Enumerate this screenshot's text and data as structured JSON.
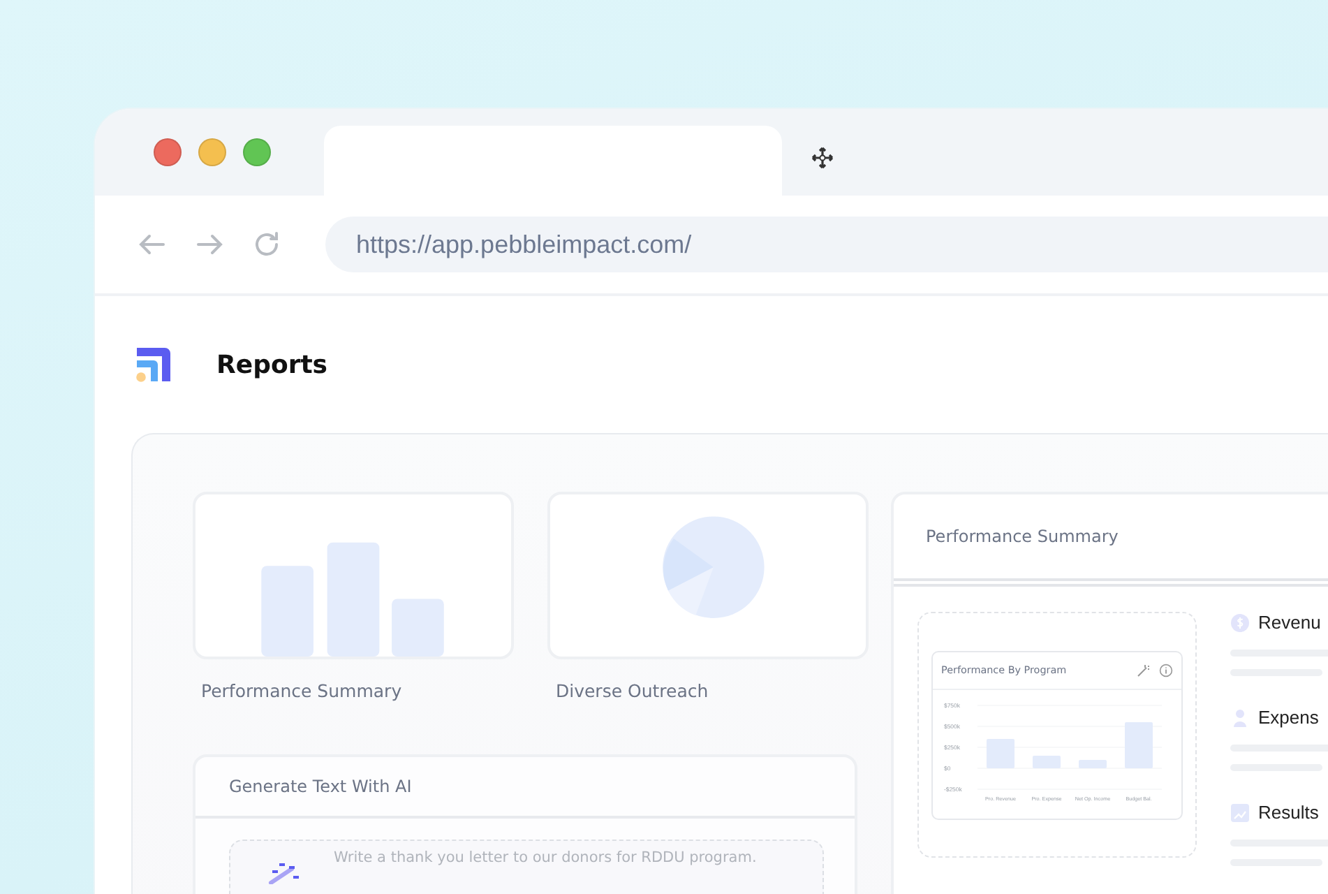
{
  "browser": {
    "controls": [
      {
        "color": "#ec6a5e"
      },
      {
        "color": "#f4bf4f"
      },
      {
        "color": "#61c554"
      }
    ],
    "url": "https://app.pebbleimpact.com/"
  },
  "page": {
    "title": "Reports"
  },
  "report_cards": [
    {
      "kind": "bar",
      "label": "Performance Summary"
    },
    {
      "kind": "pie",
      "label": "Diverse Outreach"
    }
  ],
  "ai_panel": {
    "title": "Generate Text With AI",
    "placeholder": "Write a thank you letter to our donors for RDDU program."
  },
  "summary_panel": {
    "title": "Performance Summary",
    "chart_card": {
      "title": "Performance By Program",
      "chart_data": {
        "type": "bar",
        "categories": [
          "Pro. Revenue",
          "Pro. Expense",
          "Net Op. Income",
          "Budget Bal."
        ],
        "grid": true,
        "series": [
          {
            "color": "#e3ebfb",
            "values": [
              350000,
              150000,
              100000,
              550000
            ]
          }
        ],
        "ylim": [
          -250000,
          750000
        ],
        "yticks": [
          {
            "value": 750000,
            "label": "$750k"
          },
          {
            "value": 500000,
            "label": "$500k"
          },
          {
            "value": 250000,
            "label": "$250k"
          },
          {
            "value": 0,
            "label": "$0"
          },
          {
            "value": -250000,
            "label": "-$250k"
          }
        ]
      }
    },
    "metrics": [
      {
        "kind": "revenue",
        "label": "Revenu"
      },
      {
        "kind": "expense",
        "label": "Expens"
      },
      {
        "kind": "results",
        "label": "Results"
      }
    ]
  }
}
